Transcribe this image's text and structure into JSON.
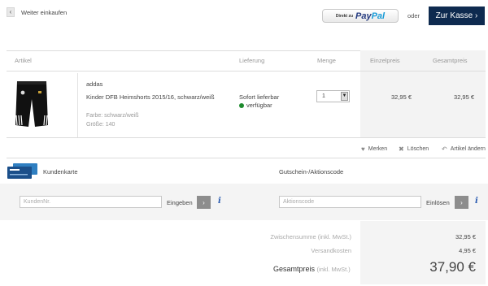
{
  "header": {
    "back_label": "Weiter einkaufen",
    "paypal_prefix": "Direkt zu",
    "paypal_word_1": "Pay",
    "paypal_word_2": "Pal",
    "or_label": "oder",
    "checkout_label": "Zur Kasse",
    "back_icon": "chevron-left-icon",
    "checkout_icon": "chevron-right-icon"
  },
  "table": {
    "headers": {
      "artikel": "Artikel",
      "lieferung": "Lieferung",
      "menge": "Menge",
      "einzelpreis": "Einzelpreis",
      "gesamtpreis": "Gesamtpreis"
    }
  },
  "item": {
    "brand": "addas",
    "name": "Kinder DFB Heimshorts 2015/16, schwarz/weiß",
    "color": "Farbe: schwarz/weiß",
    "size": "Größe: 140",
    "delivery": "Sofort lieferbar",
    "availability": "verfügbar",
    "availability_color": "#1e8b2e",
    "quantity": "1",
    "unit_price": "32,95 €",
    "total_price": "32,95 €"
  },
  "item_actions": {
    "merken": "Merken",
    "loeschen": "Löschen",
    "aendern": "Artikel ändern"
  },
  "customer_card": {
    "label": "Kundenkarte",
    "placeholder": "KundenNr.",
    "button_label": "Eingeben",
    "info": "i"
  },
  "voucher": {
    "label": "Gutschein-/Aktionscode",
    "placeholder": "Aktionscode",
    "button_label": "Einlösen",
    "info": "i"
  },
  "summary": {
    "subtotal_label": "Zwischensumme",
    "subtotal_note": "(inkl. MwSt.)",
    "subtotal_value": "32,95 €",
    "shipping_label": "Versandkosten",
    "shipping_value": "4,95 €",
    "total_label": "Gesamtpreis",
    "total_note": "(inkl. MwSt.)",
    "total_value": "37,90 €"
  },
  "colors": {
    "checkout_bg": "#0e2a4f",
    "info_blue": "#2a5bb0",
    "paypal_dark": "#253b80",
    "paypal_light": "#179bd7"
  }
}
